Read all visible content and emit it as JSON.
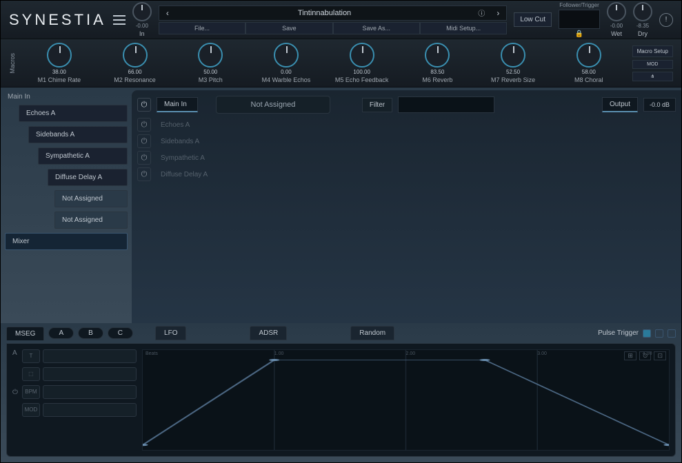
{
  "brand": "SYNESTIA",
  "header": {
    "in": {
      "value": "-0.00",
      "label": "In"
    },
    "preset": {
      "name": "Tintinnabulation",
      "buttons": [
        "File...",
        "Save",
        "Save As...",
        "Midi Setup..."
      ]
    },
    "lowcut": "Low Cut",
    "follower": "Follower/Trigger",
    "wet": {
      "value": "-0.00",
      "label": "Wet"
    },
    "dry": {
      "value": "-8.35",
      "label": "Dry"
    }
  },
  "macros": {
    "label": "Macros",
    "items": [
      {
        "value": "38.00",
        "name": "M1 Chime Rate"
      },
      {
        "value": "66.00",
        "name": "M2 Resonance"
      },
      {
        "value": "50.00",
        "name": "M3 Pitch"
      },
      {
        "value": "0.00",
        "name": "M4 Warble Echos"
      },
      {
        "value": "100.00",
        "name": "M5 Echo Feedback"
      },
      {
        "value": "83.50",
        "name": "M6 Reverb"
      },
      {
        "value": "52.50",
        "name": "M7 Reverb Size"
      },
      {
        "value": "58.00",
        "name": "M8 Choral"
      }
    ],
    "setup": "Macro Setup",
    "mod": "MOD"
  },
  "tree": {
    "root": "Main In",
    "items": [
      {
        "label": "Echoes A",
        "indent": 1
      },
      {
        "label": "Sidebands A",
        "indent": 2
      },
      {
        "label": "Sympathetic A",
        "indent": 3
      },
      {
        "label": "Diffuse Delay A",
        "indent": 4
      },
      {
        "label": "Not Assigned",
        "indent": 5,
        "na": true
      },
      {
        "label": "Not Assigned",
        "indent": 5,
        "na": true
      },
      {
        "label": "Mixer",
        "indent": 0,
        "mixer": true
      }
    ]
  },
  "channels": {
    "main": {
      "name": "Main In",
      "slot": "Not Assigned",
      "filter": "Filter",
      "output": "Output",
      "db": "-0.0 dB"
    },
    "rows": [
      "Echoes A",
      "Sidebands A",
      "Sympathetic A",
      "Diffuse Delay A"
    ]
  },
  "mod": {
    "tabs": [
      "MSEG",
      "LFO",
      "ADSR",
      "Random"
    ],
    "abc": [
      "A",
      "B",
      "C"
    ],
    "pulse": "Pulse Trigger",
    "sideLabel": "A",
    "ctrls": [
      "T",
      "⬚",
      "BPM",
      "MOD"
    ],
    "graphLabels": [
      "Beats",
      "1.00",
      "2.00",
      "3.00",
      "4.00"
    ]
  }
}
